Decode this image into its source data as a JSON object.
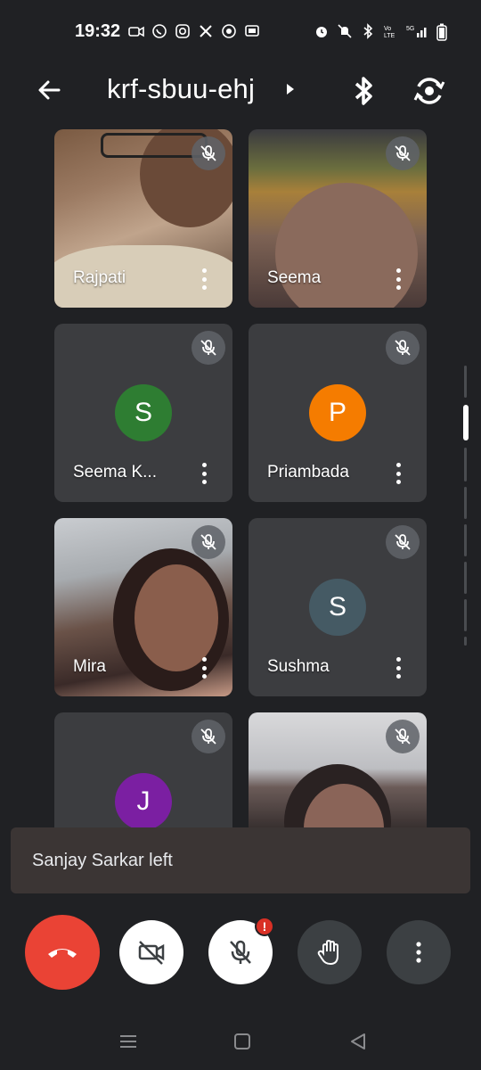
{
  "status_bar": {
    "time": "19:32",
    "left_icons": [
      "video-icon",
      "whatsapp-icon",
      "instagram-icon",
      "x-icon",
      "chrome-icon",
      "cast-icon"
    ],
    "right_icons": [
      "alarm-icon",
      "mute-icon",
      "bluetooth-icon",
      "volte-icon",
      "5g-signal-icon",
      "battery-icon"
    ]
  },
  "header": {
    "meeting_code": "krf-sbuu-ehj"
  },
  "participants": [
    {
      "name": "Rajpati",
      "video": true
    },
    {
      "name": "Seema",
      "video": true
    },
    {
      "name": "Seema K...",
      "video": false,
      "initial": "S",
      "color": "#2e7d32"
    },
    {
      "name": "Priambada",
      "video": false,
      "initial": "P",
      "color": "#f57c00"
    },
    {
      "name": "Mira",
      "video": true
    },
    {
      "name": "Sushma",
      "video": false,
      "initial": "S",
      "color": "#455a64"
    },
    {
      "name": "",
      "video": false,
      "initial": "J",
      "color": "#7b1fa2"
    },
    {
      "name": "",
      "video": true
    }
  ],
  "toast": {
    "message": "Sanjay Sarkar left"
  },
  "controls": {
    "mic_alert": "!"
  },
  "colors": {
    "background": "#202124",
    "tile": "#3c3d40",
    "end_call": "#ea4335",
    "alert": "#d93025"
  }
}
